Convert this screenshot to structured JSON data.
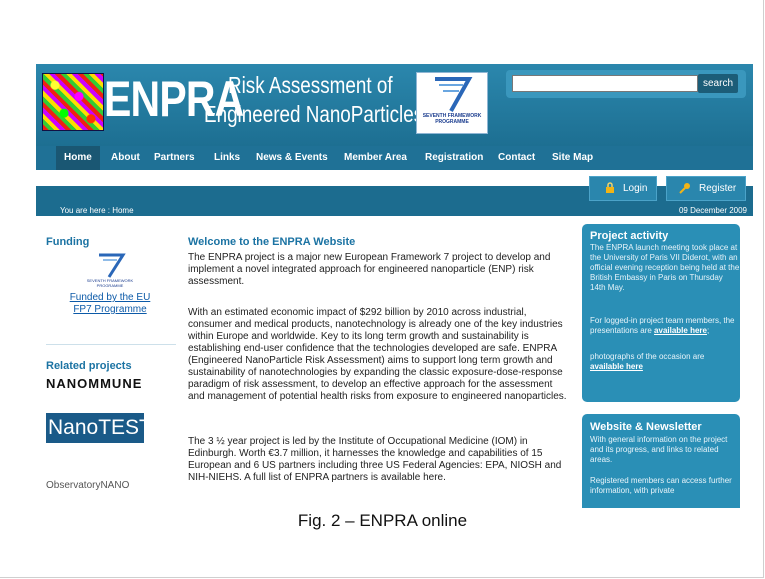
{
  "header": {
    "logo_text": "ENPRA",
    "title_line1": "Risk Assessment of",
    "title_line2": "Engineered NanoParticles",
    "fp7_label": "SEVENTH FRAMEWORK PROGRAMME",
    "search_placeholder": "",
    "search_button": "search"
  },
  "nav": {
    "items": [
      "Home",
      "About",
      "Partners",
      "Links",
      "News & Events",
      "Member Area",
      "Registration",
      "Contact",
      "Site Map"
    ],
    "active": "Home"
  },
  "auth": {
    "login": "Login",
    "register": "Register"
  },
  "breadcrumb": "You are here :  Home",
  "date": "09 December 2009",
  "left": {
    "funding_title": "Funding",
    "fp7_small_label": "SEVENTH FRAMEWORK PROGRAMME",
    "funding_link_line1": "Funded by the EU",
    "funding_link_line2": "FP7 Programme",
    "related_title": "Related projects",
    "related_logos": [
      "NANOMMUNE",
      "NanoTEST",
      "ObservatoryNANO"
    ]
  },
  "main": {
    "title": "Welcome to the ENPRA Website",
    "paragraphs": [
      "The ENPRA project is a major new European Framework 7 project to develop and implement a novel integrated approach for engineered nanoparticle (ENP) risk assessment.",
      "With an estimated economic impact of $292 billion by 2010 across industrial, consumer and medical products, nanotechnology is already one of the key industries within Europe and worldwide. Key to its long term growth and sustainability is establishing end-user confidence that the technologies developed are safe. ENPRA (Engineered NanoParticle Risk Assessment) aims to support long term growth and sustainability of nanotechnologies by expanding the classic exposure-dose-response paradigm of risk assessment, to develop an effective approach for the assessment and management of potential health risks from exposure to engineered nanoparticles.",
      "The 3 ½ year project is led by the Institute of Occupational Medicine (IOM) in  Edinburgh. Worth €3.7 million, it harnesses the knowledge and capabilities of 15 European and 6 US partners including three US Federal Agencies: EPA, NIOSH and NIH-NIEHS. A full list of ENPRA partners is available here."
    ]
  },
  "right": {
    "activity_title": "Project activity",
    "activity_text1": "The ENPRA launch meeting took place at the University of Paris VII Diderot, with an official evening reception being held at the British Embassy in Paris on Thursday 14th May.",
    "activity_text2a": "For logged-in project team members, the presentations are ",
    "activity_link1": "available here",
    "activity_text2b": ";",
    "activity_text3": "photographs of the occasion are",
    "activity_link2": "available here",
    "newsletter_title": "Website & Newsletter",
    "newsletter_text1": "With general information on the project and its progress, and links to related areas.",
    "newsletter_text2": "Registered members can access further information, with private"
  },
  "caption": "Fig. 2 – ENPRA online"
}
